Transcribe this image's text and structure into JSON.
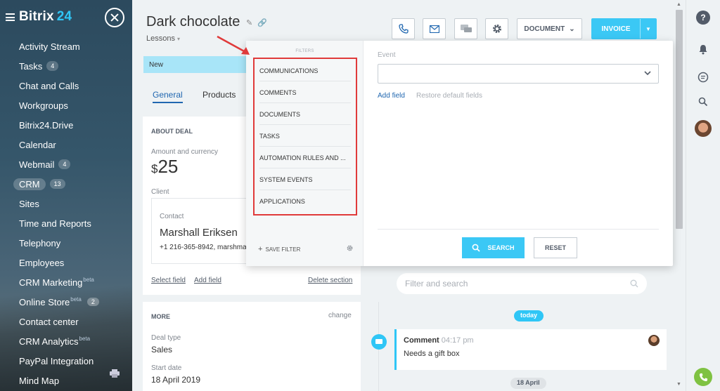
{
  "sidebar": {
    "logo": "Bitrix",
    "logo_num": "24",
    "items": [
      {
        "label": "Activity Stream"
      },
      {
        "label": "Tasks",
        "badge": "4"
      },
      {
        "label": "Chat and Calls"
      },
      {
        "label": "Workgroups"
      },
      {
        "label": "Bitrix24.Drive"
      },
      {
        "label": "Calendar"
      },
      {
        "label": "Webmail",
        "badge": "4"
      },
      {
        "label": "CRM",
        "badge": "13"
      },
      {
        "label": "Sites"
      },
      {
        "label": "Time and Reports"
      },
      {
        "label": "Telephony"
      },
      {
        "label": "Employees"
      },
      {
        "label": "CRM Marketing",
        "sup": "beta"
      },
      {
        "label": "Online Store",
        "sup": "beta",
        "badge": "2"
      },
      {
        "label": "Contact center"
      },
      {
        "label": "CRM Analytics",
        "sup": "beta"
      },
      {
        "label": "PayPal Integration"
      },
      {
        "label": "Mind Map"
      }
    ]
  },
  "header": {
    "title": "Dark chocolate",
    "breadcrumb": "Lessons",
    "document_label": "DOCUMENT",
    "invoice_label": "INVOICE"
  },
  "deal": {
    "stage": "New",
    "tabs": [
      "General",
      "Products"
    ],
    "about_title": "ABOUT DEAL",
    "amount_label": "Amount and currency",
    "currency": "$",
    "amount": "25",
    "client_label": "Client",
    "contact_label": "Contact",
    "contact_name": "Marshall Eriksen",
    "contact_phone": "+1 216-365-8942, marshma",
    "select_field": "Select field",
    "add_field": "Add field",
    "delete_section": "Delete section",
    "more_title": "MORE",
    "change": "change",
    "deal_type_label": "Deal type",
    "deal_type": "Sales",
    "start_date_label": "Start date",
    "start_date": "18 April 2019"
  },
  "timeline": {
    "filter_placeholder": "Filter and search",
    "today": "today",
    "comment_title": "Comment",
    "comment_time": "04:17 pm",
    "comment_text": "Needs a gift box",
    "date_pill": "18 April"
  },
  "filter_popup": {
    "title": "FILTERS",
    "items": [
      "COMMUNICATIONS",
      "COMMENTS",
      "DOCUMENTS",
      "TASKS",
      "AUTOMATION RULES AND ...",
      "SYSTEM EVENTS",
      "APPLICATIONS"
    ],
    "save_filter": "SAVE FILTER",
    "event_label": "Event",
    "add_field": "Add field",
    "restore": "Restore default fields",
    "search": "SEARCH",
    "reset": "RESET"
  },
  "right_panel": {
    "help": "?"
  },
  "colors": {
    "accent": "#3bc8f5",
    "highlight": "#e03a3a",
    "link": "#2067b0"
  }
}
